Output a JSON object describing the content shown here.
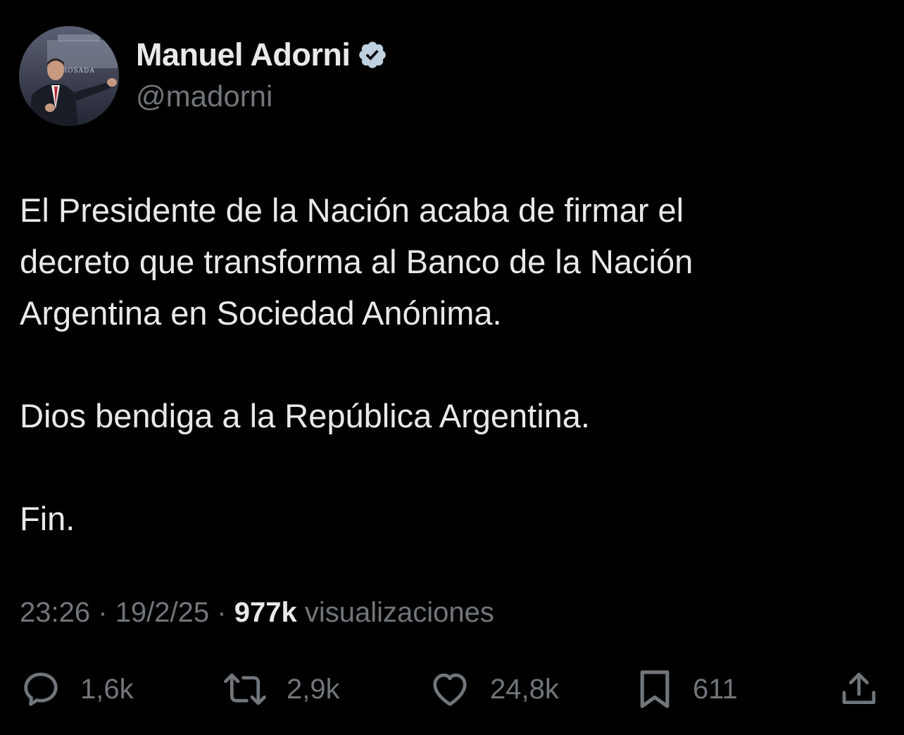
{
  "author": {
    "name": "Manuel Adorni",
    "handle": "@madorni",
    "verified": true,
    "avatar_caption": "A ROSADA"
  },
  "tweet": {
    "paragraphs": [
      "El Presidente de la Nación acaba de firmar el\ndecreto que transforma al Banco de la Nación\nArgentina en Sociedad Anónima.",
      "Dios bendiga a la República Argentina.",
      "Fin."
    ]
  },
  "meta": {
    "time": "23:26",
    "separator": "·",
    "date": "19/2/25",
    "views": "977k",
    "views_label": "visualizaciones"
  },
  "actions": {
    "replies": "1,6k",
    "reposts": "2,9k",
    "likes": "24,8k",
    "bookmarks": "611"
  },
  "colors": {
    "background": "#000000",
    "primary_text": "#e7e9ea",
    "secondary_text": "#71767b",
    "verified_badge": "#bfd0e0"
  },
  "icons": [
    "reply-icon",
    "repost-icon",
    "like-icon",
    "bookmark-icon",
    "share-icon",
    "verified-badge-icon"
  ]
}
